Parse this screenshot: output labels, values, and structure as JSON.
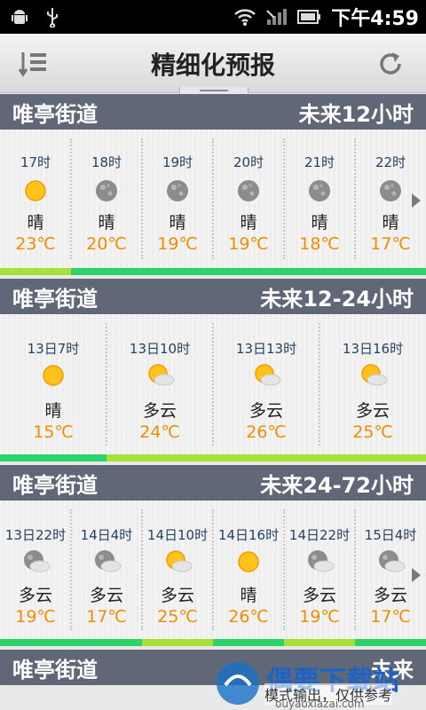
{
  "status": {
    "time": "下午4:59"
  },
  "titlebar": {
    "title": "精细化预报"
  },
  "sections": [
    {
      "location": "唯亭街道",
      "range": "未来12小时",
      "items": [
        {
          "time": "17时",
          "icon": "sun-icon",
          "desc": "晴",
          "temp": "23℃"
        },
        {
          "time": "18时",
          "icon": "moon-icon",
          "desc": "晴",
          "temp": "20℃"
        },
        {
          "time": "19时",
          "icon": "moon-icon",
          "desc": "晴",
          "temp": "19℃"
        },
        {
          "time": "20时",
          "icon": "moon-icon",
          "desc": "晴",
          "temp": "19℃"
        },
        {
          "time": "21时",
          "icon": "moon-icon",
          "desc": "晴",
          "temp": "18℃"
        },
        {
          "time": "22时",
          "icon": "moon-icon",
          "desc": "晴",
          "temp": "17℃"
        }
      ]
    },
    {
      "location": "唯亭街道",
      "range": "未来12-24小时",
      "items": [
        {
          "time": "13日7时",
          "icon": "sun-icon",
          "desc": "晴",
          "temp": "15℃"
        },
        {
          "time": "13日10时",
          "icon": "sun-cloud-icon",
          "desc": "多云",
          "temp": "24℃"
        },
        {
          "time": "13日13时",
          "icon": "sun-cloud-icon",
          "desc": "多云",
          "temp": "26℃"
        },
        {
          "time": "13日16时",
          "icon": "sun-cloud-icon",
          "desc": "多云",
          "temp": "25℃"
        }
      ]
    },
    {
      "location": "唯亭街道",
      "range": "未来24-72小时",
      "items": [
        {
          "time": "13日22时",
          "icon": "moon-cloud-icon",
          "desc": "多云",
          "temp": "19℃"
        },
        {
          "time": "14日4时",
          "icon": "moon-cloud-icon",
          "desc": "多云",
          "temp": "17℃"
        },
        {
          "time": "14日10时",
          "icon": "sun-cloud-icon",
          "desc": "多云",
          "temp": "25℃"
        },
        {
          "time": "14日16时",
          "icon": "sun-icon",
          "desc": "晴",
          "temp": "26℃"
        },
        {
          "time": "14日22时",
          "icon": "moon-cloud-icon",
          "desc": "多云",
          "temp": "19℃"
        },
        {
          "time": "15日4时",
          "icon": "moon-cloud-icon",
          "desc": "多云",
          "temp": "17℃"
        }
      ]
    },
    {
      "location": "唯亭街道",
      "range": "未来",
      "items": []
    }
  ],
  "colors": {
    "header": "#606878",
    "temp": "#f08c00",
    "bar_green": "#2ed26a",
    "bar_lime": "#a8e03a"
  },
  "watermark": {
    "title": "偶要下载站",
    "subtitle": "模式输出，仅供参考",
    "url": "ouyaoxiazai.com"
  }
}
